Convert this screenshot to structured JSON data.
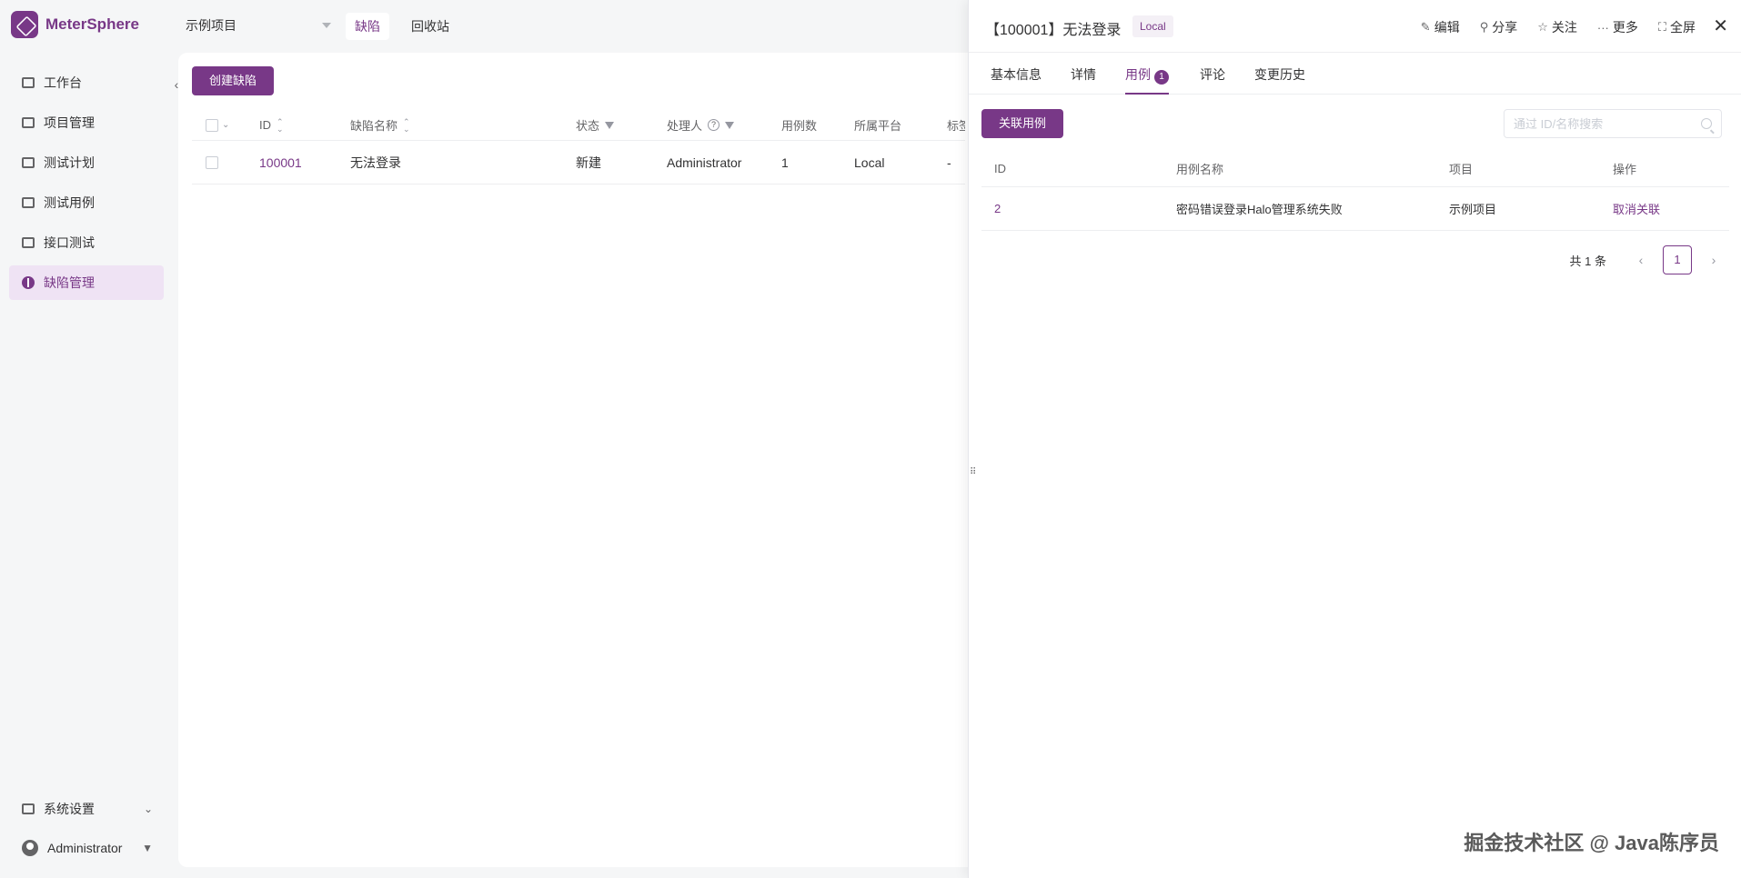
{
  "app": {
    "name": "MeterSphere"
  },
  "sidebar": {
    "items": [
      {
        "label": "工作台",
        "icon": "dashboard-icon"
      },
      {
        "label": "项目管理",
        "icon": "folder-icon"
      },
      {
        "label": "测试计划",
        "icon": "calendar-icon"
      },
      {
        "label": "测试用例",
        "icon": "case-icon"
      },
      {
        "label": "接口测试",
        "icon": "api-icon"
      },
      {
        "label": "缺陷管理",
        "icon": "bug-icon"
      }
    ],
    "settings_label": "系统设置",
    "user_label": "Administrator"
  },
  "topnav": {
    "project": "示例项目",
    "tabs": [
      {
        "label": "缺陷"
      },
      {
        "label": "回收站"
      }
    ]
  },
  "main": {
    "create_button": "创建缺陷",
    "columns": [
      "ID",
      "缺陷名称",
      "状态",
      "处理人",
      "用例数",
      "所属平台",
      "标签"
    ],
    "rows": [
      {
        "id": "100001",
        "name": "无法登录",
        "status": "新建",
        "handler": "Administrator",
        "case_count": "1",
        "platform": "Local",
        "tags": "-"
      }
    ]
  },
  "drawer": {
    "title": "【100001】无法登录",
    "badge": "Local",
    "actions": [
      {
        "label": "编辑",
        "glyph": "✎"
      },
      {
        "label": "分享",
        "glyph": "⚲"
      },
      {
        "label": "关注",
        "glyph": "☆"
      },
      {
        "label": "更多",
        "glyph": "···"
      },
      {
        "label": "全屏",
        "glyph": "⛶"
      }
    ],
    "tabs": [
      {
        "label": "基本信息"
      },
      {
        "label": "详情"
      },
      {
        "label": "用例",
        "count": "1"
      },
      {
        "label": "评论"
      },
      {
        "label": "变更历史"
      }
    ],
    "link_button": "关联用例",
    "search_placeholder": "通过 ID/名称搜索",
    "columns": [
      "ID",
      "用例名称",
      "项目",
      "操作"
    ],
    "rows": [
      {
        "id": "2",
        "name": "密码错误登录Halo管理系统失败",
        "project": "示例项目",
        "action": "取消关联"
      }
    ],
    "pagination": {
      "total": "共 1 条",
      "current": "1"
    }
  },
  "watermark": "掘金技术社区 @ Java陈序员",
  "colors": {
    "accent": "#783887",
    "accent_light": "#efe3f4"
  }
}
